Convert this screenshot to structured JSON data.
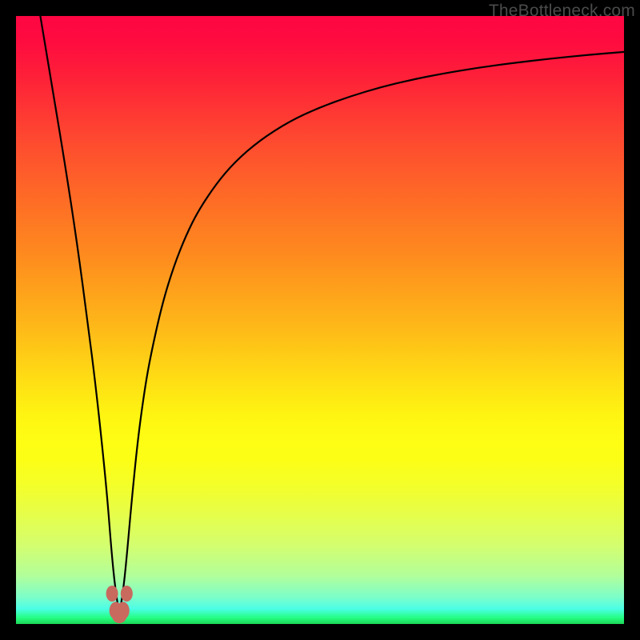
{
  "watermark": "TheBottleneck.com",
  "colors": {
    "frame": "#000000",
    "curve": "#000000",
    "marker_fill": "#c86a5e",
    "marker_stroke": "#9a4a40",
    "gradient_stops": [
      "#fe0642",
      "#fe6b26",
      "#fede14",
      "#b2fe9a",
      "#1cd656"
    ]
  },
  "chart_data": {
    "type": "line",
    "title": "",
    "xlabel": "",
    "ylabel": "",
    "xlim": [
      0,
      100
    ],
    "ylim": [
      0,
      100
    ],
    "grid": false,
    "legend": false,
    "notes": "Axes are unlabeled percentage scales inferred from plot area. Curve reaches 0 near x≈17. Values estimated from pixel positions.",
    "series": [
      {
        "name": "curve",
        "x": [
          4,
          6,
          8,
          10,
          12,
          13,
          14,
          15,
          15.7,
          16.3,
          17,
          17.7,
          18.3,
          19,
          20,
          21,
          22,
          24,
          26,
          28,
          30,
          33,
          36,
          40,
          45,
          50,
          55,
          60,
          65,
          70,
          76,
          82,
          88,
          94,
          100
        ],
        "y": [
          100,
          88,
          76,
          63,
          48,
          40,
          31,
          21,
          12,
          6,
          1.5,
          6,
          12,
          20,
          30,
          37.5,
          43.5,
          52.5,
          59,
          64,
          68,
          72.5,
          76,
          79.5,
          82.7,
          85,
          86.8,
          88.3,
          89.5,
          90.5,
          91.5,
          92.3,
          93,
          93.6,
          94.1
        ]
      }
    ],
    "markers": [
      {
        "x": 15.8,
        "y": 5.0
      },
      {
        "x": 16.4,
        "y": 2.2
      },
      {
        "x": 17.0,
        "y": 1.3
      },
      {
        "x": 17.6,
        "y": 2.2
      },
      {
        "x": 18.2,
        "y": 5.0
      }
    ]
  }
}
